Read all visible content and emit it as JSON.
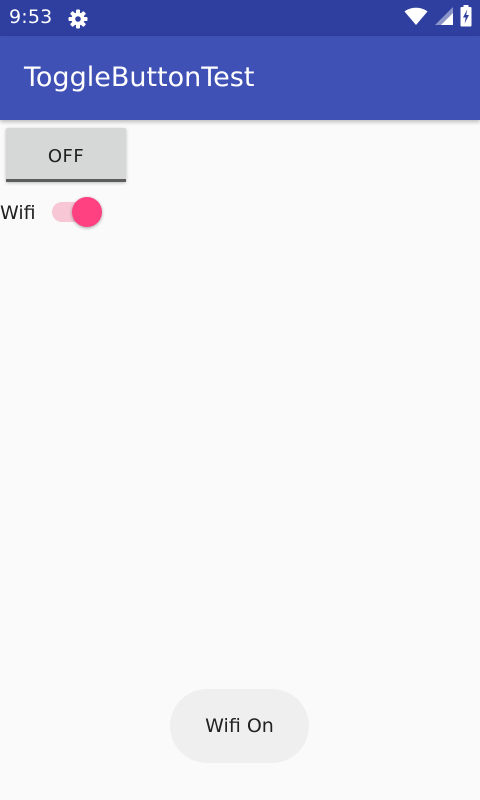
{
  "status_bar": {
    "time": "9:53",
    "icons": [
      "settings-gear-icon",
      "wifi-icon",
      "signal-icon",
      "battery-icon"
    ]
  },
  "app_bar": {
    "title": "ToggleButtonTest"
  },
  "toggle_button": {
    "label": "OFF",
    "checked": false
  },
  "wifi_switch": {
    "label": "Wifi",
    "checked": true
  },
  "toast": {
    "text": "Wifi On"
  },
  "colors": {
    "status_bar": "#2f3f9f",
    "app_bar": "#3f51b5",
    "accent": "#ff4081",
    "switch_track": "#f8c7d6",
    "background": "#fafafa"
  }
}
